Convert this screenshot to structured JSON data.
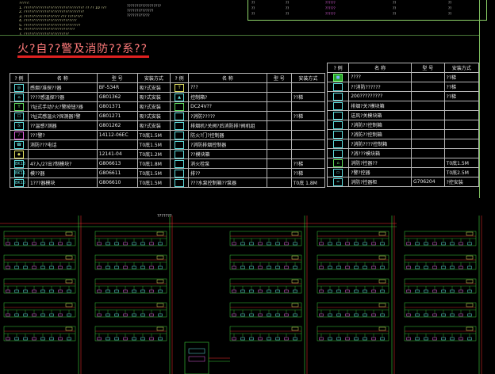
{
  "notes": {
    "lines": [
      "?????:",
      "1. ???????????????????????????????? ??  ?? 10 ???",
      "2. ????????????????????????????????",
      "3. ??????????????????? ??? ????????",
      "4. ????????????????????????????",
      "5. ??????????????????????????????",
      "6. ???????????????????????????",
      "7. ????????????????????????"
    ],
    "mid_lines": [
      "??????????????????",
      "??????????????",
      "????????????"
    ]
  },
  "top_frame": {
    "rows": [
      [
        "??",
        "??",
        "??????",
        "??",
        "??"
      ],
      [
        "??",
        "??",
        "??????",
        "??",
        "??"
      ],
      [
        "??",
        "??",
        "??????",
        "??",
        "??"
      ]
    ]
  },
  "title": "火?自??警及消防??系??",
  "left_table": {
    "headers": [
      "? 例",
      "名 称",
      "型 号",
      "安装方式",
      "? 例",
      "名 称",
      "型 号",
      "安装方式"
    ],
    "rows": [
      {
        "sym1": "◎",
        "name1": "感烟?准探??器",
        "model1": "BF-534R",
        "mount1": "吸?式安装",
        "sym2": "T",
        "name2": "???",
        "model2": "",
        "mount2": "",
        "c1": "c",
        "c2": "y"
      },
      {
        "sym1": "⌂",
        "name1": "????感温探??器",
        "model1": "G801362",
        "mount1": "吸?式安装",
        "sym2": "▲",
        "name2": "控制箱?",
        "model2": "",
        "mount2": "??梯",
        "c1": "c",
        "c2": "c"
      },
      {
        "sym1": "Y",
        "name1": "?址式手动?火?警按钮?器",
        "model1": "G801371",
        "mount1": "吸?式安装",
        "sym2": "",
        "name2": "DC24V??",
        "model2": "",
        "mount2": "",
        "c1": "g",
        "c2": "g"
      },
      {
        "sym1": "☐",
        "name1": "?址式感温火?探测器?警",
        "model1": "G801271",
        "mount1": "吸?式安装",
        "sym2": "",
        "name2": "?消防?????",
        "model2": "",
        "mount2": "??梯",
        "c1": "c",
        "c2": "c"
      },
      {
        "sym1": "Ⓢ",
        "name1": "??温感?测器",
        "model1": "G801262",
        "mount1": "吸?式安装",
        "sym2": "",
        "name2": "排烟机?关阀?后消防排?阀机组",
        "model2": "",
        "mount2": "",
        "c1": "c",
        "c2": "c"
      },
      {
        "sym1": "♪",
        "name1": "???警?",
        "model1": "14112-06EC",
        "mount1": "T0底1.5M",
        "sym2": "",
        "name2": "防火?门?控制器",
        "model2": "",
        "mount2": "",
        "c1": "m",
        "c2": "c"
      },
      {
        "sym1": "☎",
        "name1": "消防???电话",
        "model1": "",
        "mount1": "T0底1.5M",
        "sym2": "",
        "name2": "?消防排烟控制器",
        "model2": "",
        "mount2": "",
        "c1": "c",
        "c2": "c"
      },
      {
        "sym1": "◆",
        "name1": "",
        "model1": "12141-04",
        "mount1": "T0底1.2M",
        "sym2": "",
        "name2": "??模块箱",
        "model2": "",
        "mount2": "",
        "c1": "y",
        "c2": "c"
      },
      {
        "sym1": "BK13",
        "name1": "4?入/2?出?制模块?",
        "model1": "G806613",
        "mount1": "T0底1.8M",
        "sym2": "",
        "name2": "消火栓泵",
        "model2": "",
        "mount2": "??梯",
        "c1": "c",
        "c2": "c"
      },
      {
        "sym1": "BK11",
        "name1": "模??器",
        "model1": "G806611",
        "mount1": "T0底1.5M",
        "sym2": "",
        "name2": "排??",
        "model2": "",
        "mount2": "??梯",
        "c1": "c",
        "c2": "c"
      },
      {
        "sym1": "BK10",
        "name1": "1???器模块",
        "model1": "G806610",
        "mount1": "T0底1.5M",
        "sym2": "",
        "name2": "???水泵控制箱??泵器",
        "model2": "",
        "mount2": "T0底 1.8M",
        "c1": "c",
        "c2": "c"
      }
    ]
  },
  "right_table": {
    "headers": [
      "? 例",
      "名 称",
      "型 号",
      "安装方式"
    ],
    "rows": [
      {
        "sym": "■",
        "name": "????",
        "model": "",
        "mount": "??梯",
        "c": "fill"
      },
      {
        "sym": "",
        "name": "??消防??????",
        "model": "",
        "mount": "??梯",
        "c": "c"
      },
      {
        "sym": "",
        "name": "200?????????",
        "model": "",
        "mount": "??梯",
        "c": "c"
      },
      {
        "sym": "",
        "name": "排烟?关?模块箱",
        "model": "",
        "mount": "",
        "c": "c"
      },
      {
        "sym": "",
        "name": "送风?关模块箱",
        "model": "",
        "mount": "",
        "c": "c"
      },
      {
        "sym": "",
        "name": "?消防??控制箱",
        "model": "",
        "mount": "",
        "c": "c"
      },
      {
        "sym": "",
        "name": "?消防??控制箱",
        "model": "",
        "mount": "",
        "c": "c"
      },
      {
        "sym": "",
        "name": "?消防????控制箱",
        "model": "",
        "mount": "",
        "c": "c"
      },
      {
        "sym": "",
        "name": "?消???模块箱",
        "model": "",
        "mount": "",
        "c": "c"
      },
      {
        "sym": "⌂",
        "name": "消防?控器??",
        "model": "",
        "mount": "T0底1.5M",
        "c": "g"
      },
      {
        "sym": "▭",
        "name": "?警?控器",
        "model": "",
        "mount": "T0底2.5M",
        "c": "c"
      },
      {
        "sym": "═",
        "name": "消防?控器柜",
        "model": "G706204",
        "mount": "?控安装",
        "c": "c"
      }
    ]
  },
  "diagram": {
    "label": "???????"
  },
  "colors": {
    "background": "#000000",
    "title": "#ff7a7a",
    "title_bar": "#e02020",
    "grid": "#b8b8b8",
    "wire_green": "#3cd23c",
    "wire_red": "#ff3030",
    "symbol_cyan": "#5fe0e0",
    "symbol_magenta": "#e060e0"
  }
}
